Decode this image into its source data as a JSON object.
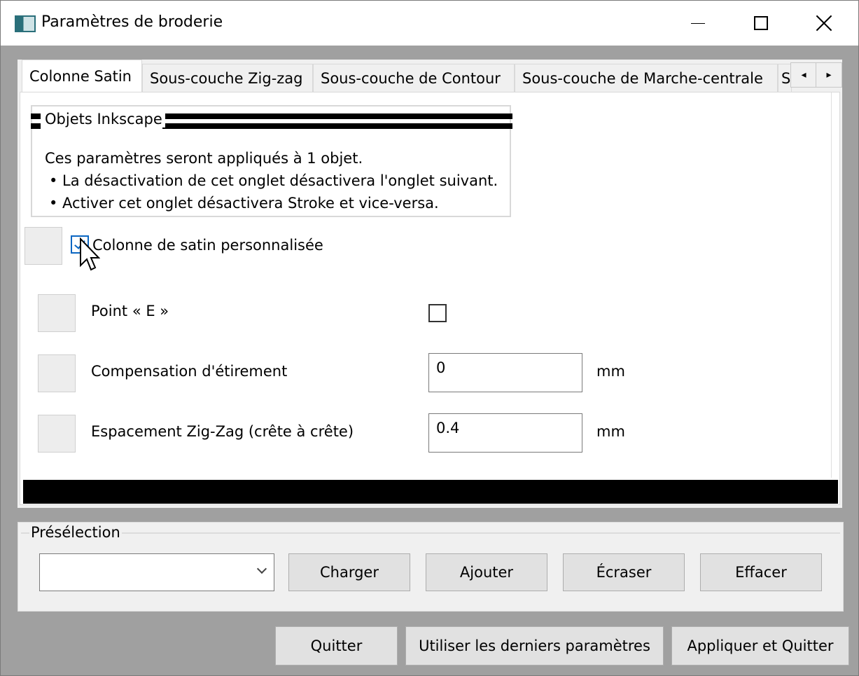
{
  "window": {
    "title": "Paramètres de broderie"
  },
  "tabs": [
    {
      "label": "Colonne Satin"
    },
    {
      "label": "Sous-couche Zig-zag"
    },
    {
      "label": "Sous-couche de Contour"
    },
    {
      "label": "Sous-couche de Marche-centrale"
    },
    {
      "label": "S"
    }
  ],
  "tab_scroll": {
    "left": "◂",
    "right": "▸"
  },
  "info_group": {
    "title": "Objets Inkscape",
    "line1": "Ces paramètres seront appliqués à 1 objet.",
    "line2": "• La désactivation de cet onglet désactivera l'onglet suivant.",
    "line3": "• Activer cet onglet désactivera Stroke et vice-versa."
  },
  "custom_satin": {
    "label": "Colonne de satin personnalisée",
    "checked": true
  },
  "params": [
    {
      "label": "Point « E »",
      "type": "checkbox",
      "checked": false
    },
    {
      "label": "Compensation d'étirement",
      "type": "text",
      "value": "0",
      "unit": "mm"
    },
    {
      "label": "Espacement Zig-Zag (crête à crête)",
      "type": "text",
      "value": "0.4",
      "unit": "mm"
    }
  ],
  "preset": {
    "title": "Présélection",
    "combo_value": "",
    "buttons": {
      "load": "Charger",
      "add": "Ajouter",
      "overwrite": "Écraser",
      "delete": "Effacer"
    }
  },
  "footer": {
    "quit": "Quitter",
    "use_last": "Utiliser les derniers paramètres",
    "apply_quit": "Appliquer et Quitter"
  },
  "colors": {
    "check_accent": "#0a66c2",
    "panel_bg": "#f0f0f0",
    "frame_bg": "#a0a0a0"
  }
}
